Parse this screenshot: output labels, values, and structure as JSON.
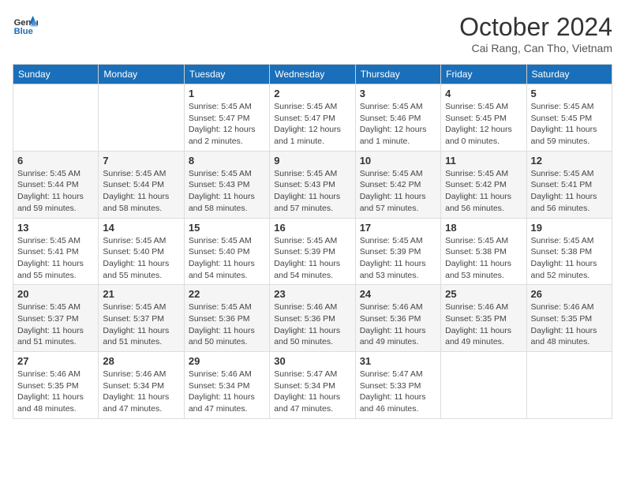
{
  "header": {
    "logo_line1": "General",
    "logo_line2": "Blue",
    "month_year": "October 2024",
    "location": "Cai Rang, Can Tho, Vietnam"
  },
  "days_of_week": [
    "Sunday",
    "Monday",
    "Tuesday",
    "Wednesday",
    "Thursday",
    "Friday",
    "Saturday"
  ],
  "weeks": [
    [
      {
        "day": "",
        "sunrise": "",
        "sunset": "",
        "daylight": ""
      },
      {
        "day": "",
        "sunrise": "",
        "sunset": "",
        "daylight": ""
      },
      {
        "day": "1",
        "sunrise": "Sunrise: 5:45 AM",
        "sunset": "Sunset: 5:47 PM",
        "daylight": "Daylight: 12 hours and 2 minutes."
      },
      {
        "day": "2",
        "sunrise": "Sunrise: 5:45 AM",
        "sunset": "Sunset: 5:47 PM",
        "daylight": "Daylight: 12 hours and 1 minute."
      },
      {
        "day": "3",
        "sunrise": "Sunrise: 5:45 AM",
        "sunset": "Sunset: 5:46 PM",
        "daylight": "Daylight: 12 hours and 1 minute."
      },
      {
        "day": "4",
        "sunrise": "Sunrise: 5:45 AM",
        "sunset": "Sunset: 5:45 PM",
        "daylight": "Daylight: 12 hours and 0 minutes."
      },
      {
        "day": "5",
        "sunrise": "Sunrise: 5:45 AM",
        "sunset": "Sunset: 5:45 PM",
        "daylight": "Daylight: 11 hours and 59 minutes."
      }
    ],
    [
      {
        "day": "6",
        "sunrise": "Sunrise: 5:45 AM",
        "sunset": "Sunset: 5:44 PM",
        "daylight": "Daylight: 11 hours and 59 minutes."
      },
      {
        "day": "7",
        "sunrise": "Sunrise: 5:45 AM",
        "sunset": "Sunset: 5:44 PM",
        "daylight": "Daylight: 11 hours and 58 minutes."
      },
      {
        "day": "8",
        "sunrise": "Sunrise: 5:45 AM",
        "sunset": "Sunset: 5:43 PM",
        "daylight": "Daylight: 11 hours and 58 minutes."
      },
      {
        "day": "9",
        "sunrise": "Sunrise: 5:45 AM",
        "sunset": "Sunset: 5:43 PM",
        "daylight": "Daylight: 11 hours and 57 minutes."
      },
      {
        "day": "10",
        "sunrise": "Sunrise: 5:45 AM",
        "sunset": "Sunset: 5:42 PM",
        "daylight": "Daylight: 11 hours and 57 minutes."
      },
      {
        "day": "11",
        "sunrise": "Sunrise: 5:45 AM",
        "sunset": "Sunset: 5:42 PM",
        "daylight": "Daylight: 11 hours and 56 minutes."
      },
      {
        "day": "12",
        "sunrise": "Sunrise: 5:45 AM",
        "sunset": "Sunset: 5:41 PM",
        "daylight": "Daylight: 11 hours and 56 minutes."
      }
    ],
    [
      {
        "day": "13",
        "sunrise": "Sunrise: 5:45 AM",
        "sunset": "Sunset: 5:41 PM",
        "daylight": "Daylight: 11 hours and 55 minutes."
      },
      {
        "day": "14",
        "sunrise": "Sunrise: 5:45 AM",
        "sunset": "Sunset: 5:40 PM",
        "daylight": "Daylight: 11 hours and 55 minutes."
      },
      {
        "day": "15",
        "sunrise": "Sunrise: 5:45 AM",
        "sunset": "Sunset: 5:40 PM",
        "daylight": "Daylight: 11 hours and 54 minutes."
      },
      {
        "day": "16",
        "sunrise": "Sunrise: 5:45 AM",
        "sunset": "Sunset: 5:39 PM",
        "daylight": "Daylight: 11 hours and 54 minutes."
      },
      {
        "day": "17",
        "sunrise": "Sunrise: 5:45 AM",
        "sunset": "Sunset: 5:39 PM",
        "daylight": "Daylight: 11 hours and 53 minutes."
      },
      {
        "day": "18",
        "sunrise": "Sunrise: 5:45 AM",
        "sunset": "Sunset: 5:38 PM",
        "daylight": "Daylight: 11 hours and 53 minutes."
      },
      {
        "day": "19",
        "sunrise": "Sunrise: 5:45 AM",
        "sunset": "Sunset: 5:38 PM",
        "daylight": "Daylight: 11 hours and 52 minutes."
      }
    ],
    [
      {
        "day": "20",
        "sunrise": "Sunrise: 5:45 AM",
        "sunset": "Sunset: 5:37 PM",
        "daylight": "Daylight: 11 hours and 51 minutes."
      },
      {
        "day": "21",
        "sunrise": "Sunrise: 5:45 AM",
        "sunset": "Sunset: 5:37 PM",
        "daylight": "Daylight: 11 hours and 51 minutes."
      },
      {
        "day": "22",
        "sunrise": "Sunrise: 5:45 AM",
        "sunset": "Sunset: 5:36 PM",
        "daylight": "Daylight: 11 hours and 50 minutes."
      },
      {
        "day": "23",
        "sunrise": "Sunrise: 5:46 AM",
        "sunset": "Sunset: 5:36 PM",
        "daylight": "Daylight: 11 hours and 50 minutes."
      },
      {
        "day": "24",
        "sunrise": "Sunrise: 5:46 AM",
        "sunset": "Sunset: 5:36 PM",
        "daylight": "Daylight: 11 hours and 49 minutes."
      },
      {
        "day": "25",
        "sunrise": "Sunrise: 5:46 AM",
        "sunset": "Sunset: 5:35 PM",
        "daylight": "Daylight: 11 hours and 49 minutes."
      },
      {
        "day": "26",
        "sunrise": "Sunrise: 5:46 AM",
        "sunset": "Sunset: 5:35 PM",
        "daylight": "Daylight: 11 hours and 48 minutes."
      }
    ],
    [
      {
        "day": "27",
        "sunrise": "Sunrise: 5:46 AM",
        "sunset": "Sunset: 5:35 PM",
        "daylight": "Daylight: 11 hours and 48 minutes."
      },
      {
        "day": "28",
        "sunrise": "Sunrise: 5:46 AM",
        "sunset": "Sunset: 5:34 PM",
        "daylight": "Daylight: 11 hours and 47 minutes."
      },
      {
        "day": "29",
        "sunrise": "Sunrise: 5:46 AM",
        "sunset": "Sunset: 5:34 PM",
        "daylight": "Daylight: 11 hours and 47 minutes."
      },
      {
        "day": "30",
        "sunrise": "Sunrise: 5:47 AM",
        "sunset": "Sunset: 5:34 PM",
        "daylight": "Daylight: 11 hours and 47 minutes."
      },
      {
        "day": "31",
        "sunrise": "Sunrise: 5:47 AM",
        "sunset": "Sunset: 5:33 PM",
        "daylight": "Daylight: 11 hours and 46 minutes."
      },
      {
        "day": "",
        "sunrise": "",
        "sunset": "",
        "daylight": ""
      },
      {
        "day": "",
        "sunrise": "",
        "sunset": "",
        "daylight": ""
      }
    ]
  ]
}
